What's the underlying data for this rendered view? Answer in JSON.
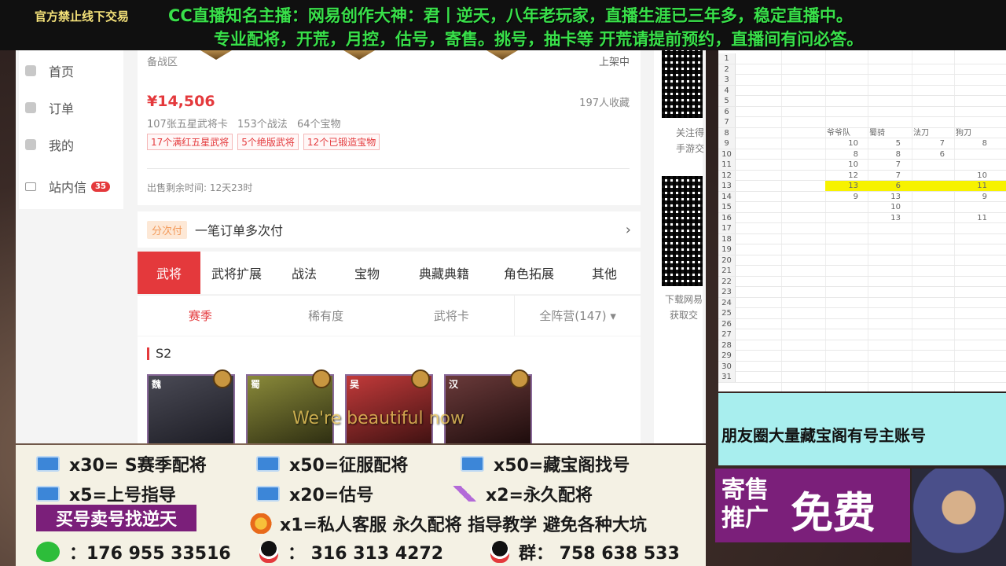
{
  "banner": {
    "tag": "官方禁止线下交易",
    "line1": "CC直播知名主播：网易创作大神：君丨逆天，八年老玩家，直播生涯已三年多，稳定直播中。",
    "line2": "专业配将，开荒，月控，估号，寄售。挑号，抽卡等  开荒请提前预约，直播间有问必答。"
  },
  "sidebar": {
    "items": [
      {
        "label": "首页"
      },
      {
        "label": "订单"
      },
      {
        "label": "我的"
      },
      {
        "label": "站内信",
        "badge": "35"
      }
    ]
  },
  "listing": {
    "server": "备战区",
    "status": "上架中",
    "price": "¥14,506",
    "favorites": "197人收藏",
    "stats": [
      "107张五星武将卡",
      "153个战法",
      "64个宝物"
    ],
    "tags": [
      "17个满红五星武将",
      "5个绝版武将",
      "12个已锻造宝物"
    ],
    "timer": "出售剩余时间: 12天23时"
  },
  "payment": {
    "badge": "分次付",
    "text": "一笔订单多次付",
    "chevron": "›"
  },
  "tabs": [
    "武将",
    "武将扩展",
    "战法",
    "宝物",
    "典藏典籍",
    "角色拓展",
    "其他"
  ],
  "filters": [
    "赛季",
    "稀有度",
    "武将卡",
    "全阵营(147) ▾"
  ],
  "season": "S2",
  "hero_factions": [
    "魏",
    "蜀",
    "吴",
    "汉"
  ],
  "right_col": {
    "qr1_label": "关注得",
    "qr1_label2": "手游交",
    "qr2_label": "下载网易",
    "qr2_label2": "获取交"
  },
  "spreadsheet": {
    "headers": [
      "爷爷队",
      "蜀骑",
      "法刀",
      "狗刀"
    ],
    "row_numbers": [
      "1",
      "2",
      "3",
      "4",
      "5",
      "6",
      "7",
      "8",
      "9",
      "10",
      "11",
      "12",
      "13",
      "14",
      "15",
      "16",
      "17",
      "18",
      "19",
      "20",
      "21",
      "22",
      "23",
      "24",
      "25",
      "26",
      "27",
      "28",
      "29",
      "30",
      "31"
    ],
    "rows": {
      "9": [
        "10",
        "5",
        "7",
        "8"
      ],
      "10": [
        "8",
        "8",
        "6",
        ""
      ],
      "11": [
        "10",
        "7",
        "",
        ""
      ],
      "12": [
        "12",
        "7",
        "",
        "10"
      ],
      "13": [
        "13",
        "6",
        "",
        "11"
      ],
      "14": [
        "9",
        "13",
        "",
        "9"
      ],
      "15": [
        "",
        "10",
        "",
        ""
      ],
      "16": [
        "",
        "13",
        "",
        "11"
      ]
    }
  },
  "promo": {
    "text": "朋友圈大量藏宝阁有号主账号",
    "sale_small_1": "寄售",
    "sale_small_2": "推广",
    "sale_big": "免费"
  },
  "subtitle": "We're beautiful now",
  "info": {
    "i1": "x30= S赛季配将",
    "i2": "x50=征服配将",
    "i3": "x50=藏宝阁找号",
    "i4": "x5=上号指导",
    "i5": "x20=估号",
    "i6": "x2=永久配将",
    "buy": "买号卖号找逆天",
    "i7": "x1=私人客服 永久配将  指导教学 避免各种大坑",
    "wechat": "：176 955 33516",
    "qq": "： 316 313 4272",
    "group": "群： 758 638 533"
  }
}
